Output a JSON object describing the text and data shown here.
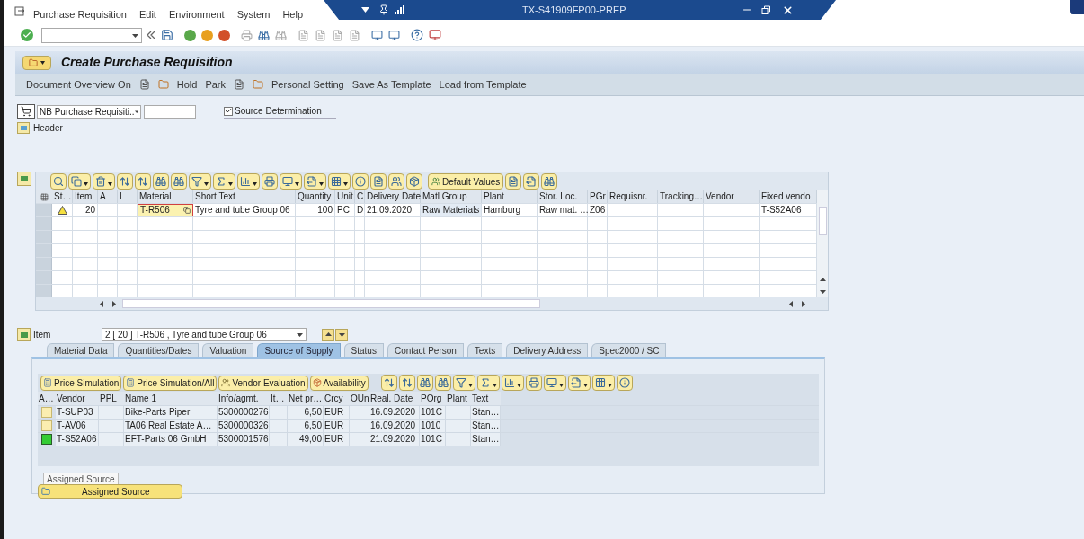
{
  "menu_bar": {
    "items": [
      "Purchase Requisition",
      "Edit",
      "Environment",
      "System",
      "Help"
    ]
  },
  "window": {
    "title": "TX-S41909FP00-PREP"
  },
  "screen_title": "Create Purchase Requisition",
  "app_toolbar": {
    "buttons": [
      {
        "kind": "text",
        "label": "Document Overview On"
      },
      {
        "kind": "icon",
        "label": "Hold"
      },
      {
        "kind": "text",
        "label": "Park"
      },
      {
        "kind": "icon",
        "label": "Personal Setting"
      },
      {
        "kind": "text",
        "label": "Save As Template"
      },
      {
        "kind": "text",
        "label": "Load from Template"
      }
    ]
  },
  "document_type": {
    "value": "NB Purchase Requisiti..",
    "checkbox": {
      "label": "Source Determination",
      "checked": true
    }
  },
  "header": {
    "label": "Header"
  },
  "items_grid": {
    "toolbar_button": "Default Values",
    "columns": [
      {
        "label": "St…",
        "kind": "status"
      },
      {
        "label": "Item",
        "kind": "number"
      },
      {
        "label": "A",
        "kind": "text"
      },
      {
        "label": "I",
        "kind": "text"
      },
      {
        "label": "Material",
        "kind": "input"
      },
      {
        "label": "Short Text",
        "kind": "text"
      },
      {
        "label": "Quantity",
        "kind": "number"
      },
      {
        "label": "Unit",
        "kind": "text"
      },
      {
        "label": "C",
        "kind": "text"
      },
      {
        "label": "Delivery Date",
        "kind": "text"
      },
      {
        "label": "Matl Group",
        "kind": "key"
      },
      {
        "label": "Plant",
        "kind": "text"
      },
      {
        "label": "Stor. Loc.",
        "kind": "text"
      },
      {
        "label": "PGr",
        "kind": "text"
      },
      {
        "label": "Requisnr.",
        "kind": "text"
      },
      {
        "label": "Tracking…",
        "kind": "text"
      },
      {
        "label": "Vendor",
        "kind": "text"
      },
      {
        "label": "Fixed vendo",
        "kind": "text"
      }
    ],
    "rows": [
      {
        "warning": true,
        "cells": [
          null,
          "20",
          null,
          null,
          "T-R506",
          "Tyre and tube Group 06",
          "100",
          "PC",
          "D",
          "21.09.2020",
          "Raw Materials",
          "Hamburg",
          "Raw mat. …",
          "Z06",
          null,
          null,
          null,
          "T-S52A06"
        ]
      }
    ]
  },
  "item_selector": {
    "label": "Item",
    "value": "2 [ 20 ] T-R506 , Tyre and tube Group 06"
  },
  "tabs": [
    {
      "label": "Material Data",
      "selected": false
    },
    {
      "label": "Quantities/Dates",
      "selected": false
    },
    {
      "label": "Valuation",
      "selected": false
    },
    {
      "label": "Source of Supply",
      "selected": true
    },
    {
      "label": "Status",
      "selected": false
    },
    {
      "label": "Contact Person",
      "selected": false
    },
    {
      "label": "Texts",
      "selected": false
    },
    {
      "label": "Delivery Address",
      "selected": false
    },
    {
      "label": "Spec2000 / SC",
      "selected": false
    }
  ],
  "source_of_supply": {
    "buttons": [
      "Price Simulation",
      "Price Simulation/All",
      "Vendor Evaluation",
      "Availability"
    ],
    "columns": [
      {
        "label": "A…",
        "kind": "marker"
      },
      {
        "label": "Vendor",
        "kind": "text"
      },
      {
        "label": "PPL",
        "kind": "text"
      },
      {
        "label": "Name 1",
        "kind": "text"
      },
      {
        "label": "Info/agmt.",
        "kind": "text"
      },
      {
        "label": "It…",
        "kind": "text"
      },
      {
        "label": "Net pr…",
        "kind": "number"
      },
      {
        "label": "Crcy",
        "kind": "text"
      },
      {
        "label": "OUn",
        "kind": "text"
      },
      {
        "label": "Real. Date",
        "kind": "text"
      },
      {
        "label": "POrg",
        "kind": "text"
      },
      {
        "label": "Plant",
        "kind": "text"
      },
      {
        "label": "Text",
        "kind": "text"
      }
    ],
    "rows": [
      {
        "assigned": false,
        "cells": [
          null,
          "T-SUP03",
          null,
          "Bike-Parts Piper",
          "5300000276",
          null,
          "6,50",
          "EUR",
          null,
          "16.09.2020",
          "101C",
          null,
          "Stan…"
        ]
      },
      {
        "assigned": false,
        "cells": [
          null,
          "T-AV06",
          null,
          "TA06 Real Estate A…",
          "5300000326",
          null,
          "6,50",
          "EUR",
          null,
          "16.09.2020",
          "1010",
          null,
          "Stan…"
        ]
      },
      {
        "assigned": true,
        "cells": [
          null,
          "T-S52A06",
          null,
          "EFT-Parts 06 GmbH",
          "5300001576",
          null,
          "49,00",
          "EUR",
          null,
          "21.09.2020",
          "101C",
          null,
          "Stan…"
        ]
      }
    ],
    "tooltip": "Assigned Source",
    "assign_button": "Assigned Source"
  }
}
